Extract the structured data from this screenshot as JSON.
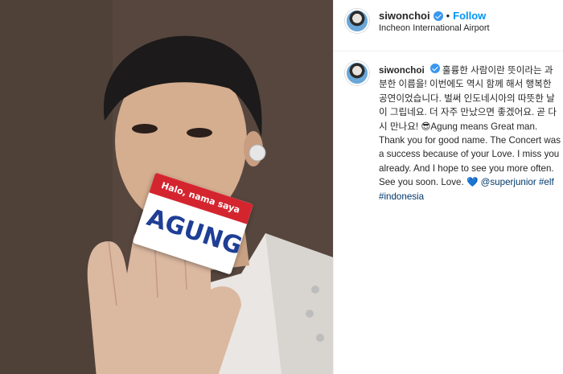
{
  "post": {
    "photo": {
      "name_tag": {
        "top_text": "Halo, nama saya",
        "name": "AGUNG"
      }
    },
    "header": {
      "username": "siwonchoi",
      "follow_label": "Follow",
      "separator": "•",
      "location": "Incheon International Airport"
    },
    "caption": {
      "username": "siwonchoi",
      "text": "훌륭한 사람이란 뜻이라는 과분한 이름을! 이번에도 역시 함께 해서 행복한 공연이었습니다. 벌써 인도네시아의 따뜻한 날이 그립네요. 더 자주 만났으면 좋겠어요. 곧 다시 만나요! 😎Agung means Great man. Thank you for good name. The Concert was a success because of your Love. I miss you already. And I hope to see you more often. See you soon. Love. ",
      "heart": "💙",
      "mention": "@superjunior",
      "hashtag1": "#elf",
      "hashtag2": "#indonesia"
    },
    "colors": {
      "follow": "#0095f6",
      "verified": "#3897f0",
      "tag_band": "#d4252f",
      "tag_name": "#1f3e95"
    }
  }
}
